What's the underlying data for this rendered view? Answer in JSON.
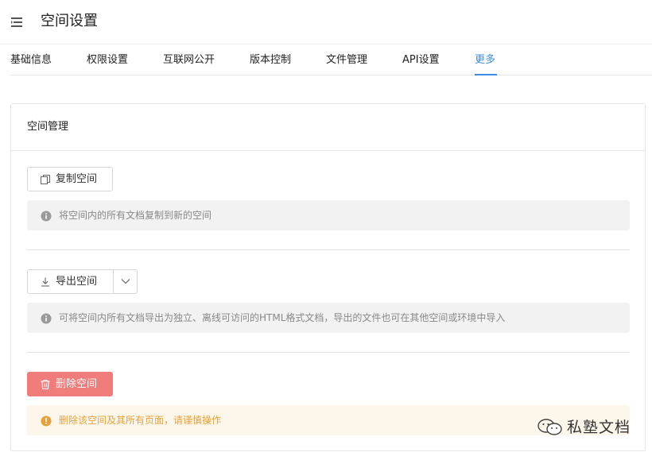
{
  "header": {
    "title": "空间设置",
    "menu_icon": "menu-icon"
  },
  "tabs": [
    {
      "label": "基础信息",
      "active": false
    },
    {
      "label": "权限设置",
      "active": false
    },
    {
      "label": "互联网公开",
      "active": false
    },
    {
      "label": "版本控制",
      "active": false
    },
    {
      "label": "文件管理",
      "active": false
    },
    {
      "label": "API设置",
      "active": false
    },
    {
      "label": "更多",
      "active": true
    }
  ],
  "card": {
    "title": "空间管理",
    "copy": {
      "button_label": "复制空间",
      "button_icon": "copy-icon",
      "info": "将空间内的所有文档复制到新的空间",
      "info_icon": "info-icon"
    },
    "export": {
      "button_label": "导出空间",
      "button_icon": "download-icon",
      "dropdown_icon": "chevron-down-icon",
      "info": "可将空间内所有文档导出为独立、离线可访问的HTML格式文档，导出的文件也可在其他空间或环境中导入",
      "info_icon": "info-icon"
    },
    "delete": {
      "button_label": "删除空间",
      "button_icon": "trash-icon",
      "warning": "删除该空间及其所有页面，请谨慎操作",
      "warning_icon": "warning-icon"
    }
  },
  "watermark": {
    "text": "私塾文档",
    "icon": "wechat-icon"
  },
  "colors": {
    "accent": "#3c8ce6",
    "danger": "#f07c7c",
    "warning": "#e6a23c",
    "info_bg": "#f2f2f2",
    "warning_bg": "#fdf6ea"
  }
}
